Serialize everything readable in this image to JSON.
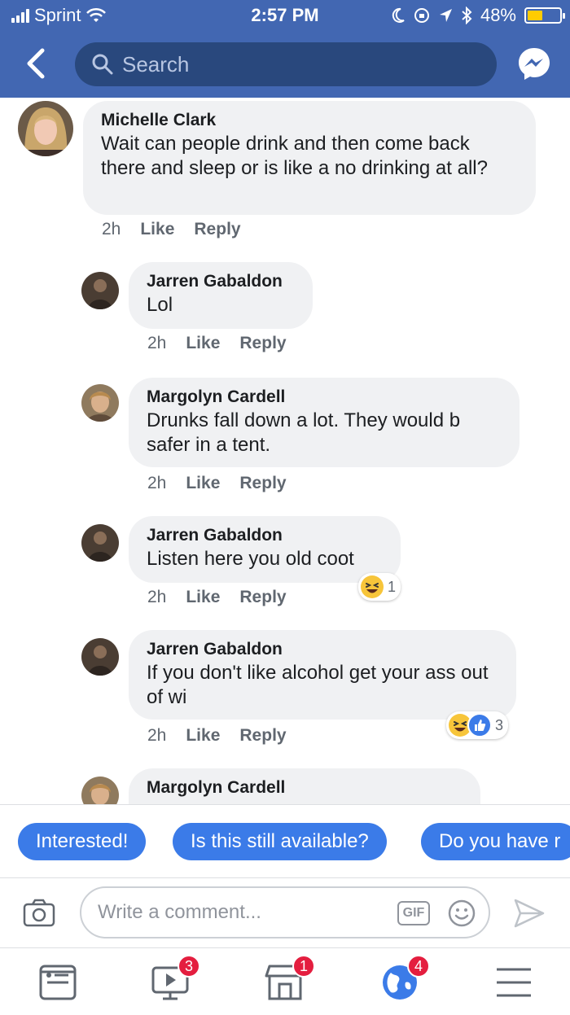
{
  "status_bar": {
    "carrier": "Sprint",
    "time": "2:57 PM",
    "battery": "48%",
    "battery_level": 0.48
  },
  "nav": {
    "search_placeholder": "Search"
  },
  "comments": [
    {
      "author": "Michelle Clark",
      "text": "Wait can people drink and then come back there and sleep or is like a no drinking at all?",
      "time": "2h",
      "like": "Like",
      "reply": "Reply"
    },
    {
      "author": "Jarren Gabaldon",
      "text": "Lol",
      "time": "2h",
      "like": "Like",
      "reply": "Reply"
    },
    {
      "author": "Margolyn Cardell",
      "text": "Drunks fall down a lot. They would b safer in a tent.",
      "time": "2h",
      "like": "Like",
      "reply": "Reply"
    },
    {
      "author": "Jarren Gabaldon",
      "text": "Listen here you old coot",
      "time": "2h",
      "like": "Like",
      "reply": "Reply",
      "reactions": [
        "haha"
      ],
      "reaction_count": "1"
    },
    {
      "author": "Jarren Gabaldon",
      "text": "If you don't like alcohol get your ass out of wi",
      "time": "2h",
      "like": "Like",
      "reply": "Reply",
      "reactions": [
        "haha",
        "like"
      ],
      "reaction_count": "3"
    },
    {
      "author": "Margolyn Cardell"
    }
  ],
  "quick_replies": [
    "Interested!",
    "Is this still available?",
    "Do you have r"
  ],
  "composer": {
    "placeholder": "Write a comment...",
    "gif_label": "GIF"
  },
  "tabbar": {
    "tabs": [
      {
        "icon": "news-feed-icon",
        "badge": ""
      },
      {
        "icon": "video-icon",
        "badge": "3"
      },
      {
        "icon": "marketplace-icon",
        "badge": "1"
      },
      {
        "icon": "notifications-globe-icon",
        "badge": "4"
      },
      {
        "icon": "menu-icon",
        "badge": ""
      }
    ]
  },
  "colors": {
    "header": "#4267b2",
    "search_bg": "#29487d",
    "bubble": "#f0f1f3",
    "chip": "#3b7be8",
    "badge": "#e41e3f"
  }
}
